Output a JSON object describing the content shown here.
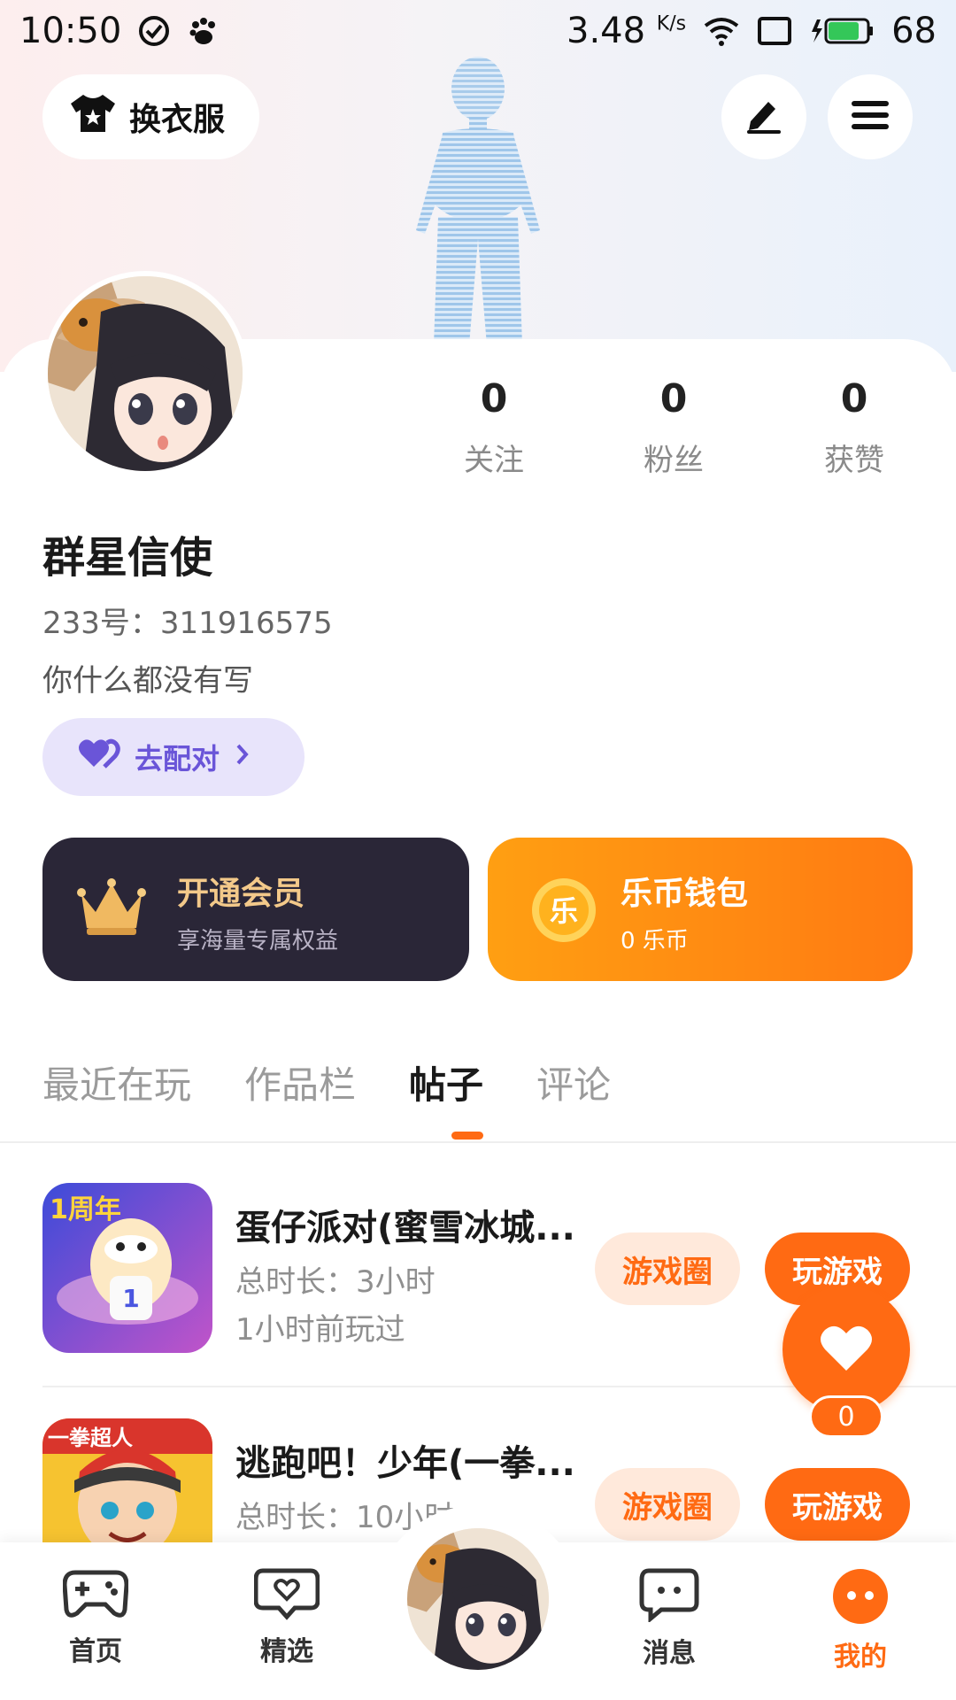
{
  "status_bar": {
    "time": "10:50",
    "speed": "3.48",
    "speed_unit": "K/s",
    "battery": "68"
  },
  "header": {
    "outfit_label": "换衣服",
    "edit_icon": "edit-pen-icon",
    "menu_icon": "menu-icon"
  },
  "profile": {
    "username": "群星信使",
    "uid": "233号：311916575",
    "bio": "你什么都没有写",
    "match_label": "去配对",
    "stats": [
      {
        "value": "0",
        "label": "关注"
      },
      {
        "value": "0",
        "label": "粉丝"
      },
      {
        "value": "0",
        "label": "获赞"
      }
    ]
  },
  "cards": {
    "vip_title": "开通会员",
    "vip_sub": "享海量专属权益",
    "coin_title": "乐币钱包",
    "coin_sub": "0 乐币",
    "coin_glyph": "乐"
  },
  "tabs": [
    "最近在玩",
    "作品栏",
    "帖子",
    "评论"
  ],
  "active_tab": "帖子",
  "games": [
    {
      "title": "蛋仔派对(蜜雪冰城...",
      "duration": "总时长：3小时",
      "last_played": "1小时前玩过",
      "circle_label": "游戏圈",
      "play_label": "玩游戏",
      "badge": "1周年"
    },
    {
      "title": "逃跑吧！少年(一拳...",
      "duration": "总时长：10小时",
      "circle_label": "游戏圈",
      "play_label": "玩游戏",
      "badge": "一拳超人"
    }
  ],
  "like_count": "0",
  "nav": [
    {
      "label": "首页",
      "icon": "gamepad-icon"
    },
    {
      "label": "精选",
      "icon": "heart-chat-icon"
    },
    {
      "label": "消息",
      "icon": "message-icon"
    },
    {
      "label": "我的",
      "icon": "profile-face-icon"
    }
  ],
  "colors": {
    "accent": "#ff6a13",
    "vip_bg": "#2a2637",
    "match_bg": "#e8e4fb"
  }
}
